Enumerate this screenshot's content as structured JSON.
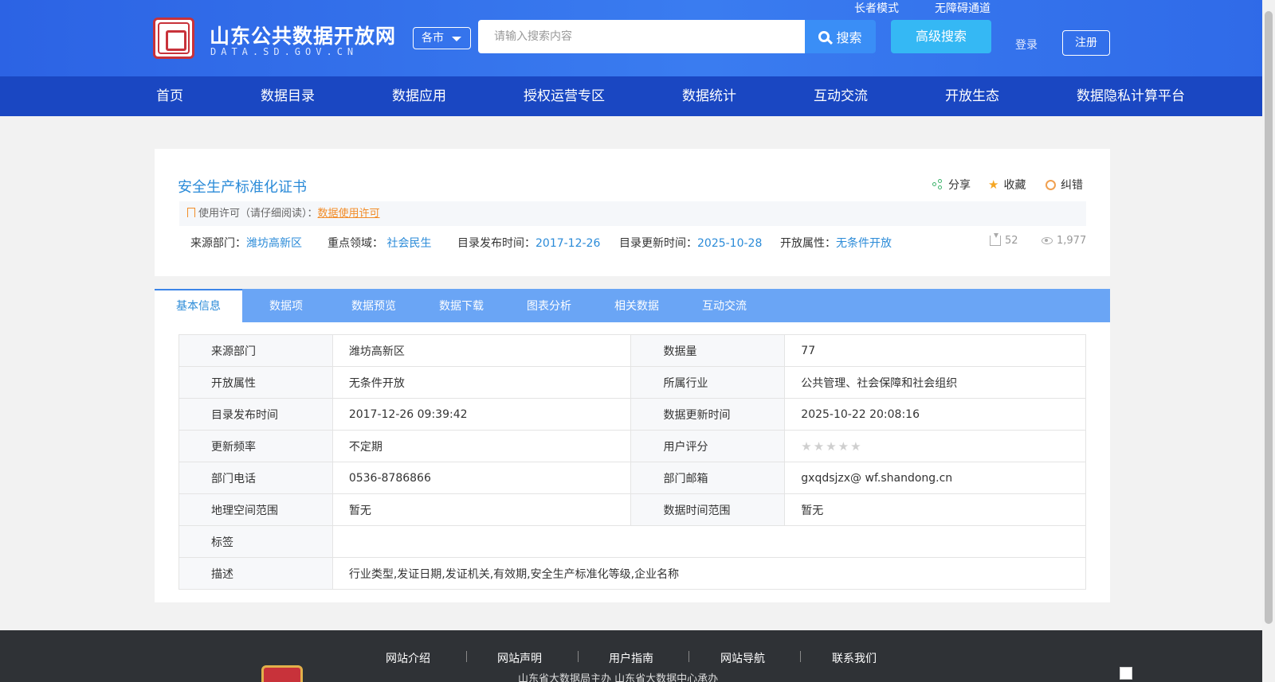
{
  "header": {
    "site_title": "山东公共数据开放网",
    "site_domain": "DATA.SD.GOV.CN",
    "top_links": [
      "长者模式",
      "无障碍通道"
    ],
    "city_select": "各市",
    "search_placeholder": "请输入搜索内容",
    "search_label": "搜索",
    "advanced_search_label": "高级搜索",
    "login_label": "登录",
    "register_label": "注册",
    "brand_color": "#2c63e4"
  },
  "nav": {
    "items": [
      "首页",
      "数据目录",
      "数据应用",
      "授权运营专区",
      "数据统计",
      "互动交流",
      "开放生态",
      "数据隐私计算平台"
    ]
  },
  "dataset": {
    "title": "安全生产标准化证书",
    "actions": {
      "share": "分享",
      "favorite": "收藏",
      "report": "纠错"
    },
    "license_prefix": "使用许可（请仔细阅读）：",
    "license_link": "数据使用许可",
    "meta": [
      {
        "label": "来源部门：",
        "value": "潍坊高新区"
      },
      {
        "label": "重点领域：",
        "value": "社会民生"
      },
      {
        "label": "目录发布时间：",
        "value": "2017-12-26"
      },
      {
        "label": "目录更新时间：",
        "value": "2025-10-28"
      },
      {
        "label": "开放属性：",
        "value": "无条件开放"
      }
    ],
    "downloads": "52",
    "views": "1,977"
  },
  "tabs": [
    "基本信息",
    "数据项",
    "数据预览",
    "数据下载",
    "图表分析",
    "相关数据",
    "互动交流"
  ],
  "active_tab": "基本信息",
  "info": {
    "rows": [
      [
        "来源部门",
        "潍坊高新区",
        "数据量",
        "77"
      ],
      [
        "开放属性",
        "无条件开放",
        "所属行业",
        "公共管理、社会保障和社会组织"
      ],
      [
        "目录发布时间",
        "2017-12-26 09:39:42",
        "数据更新时间",
        "2025-10-22 20:08:16"
      ],
      [
        "更新频率",
        "不定期",
        "用户评分",
        ""
      ],
      [
        "部门电话",
        "0536-8786866",
        "部门邮箱",
        "gxqdsjzx@ wf.shandong.cn"
      ],
      [
        "地理空间范围",
        "暂无",
        "数据时间范围",
        "暂无"
      ]
    ],
    "rating_stars": "★★★★★",
    "tags_label": "标签",
    "tags_value": "",
    "desc_label": "描述",
    "desc_value": "行业类型,发证日期,发证机关,有效期,安全生产标准化等级,企业名称"
  },
  "footer": {
    "links": [
      "网站介绍",
      "网站声明",
      "用户指南",
      "网站导航",
      "联系我们"
    ],
    "sponsor": "山东省大数据局主办    山东省大数据中心承办"
  }
}
